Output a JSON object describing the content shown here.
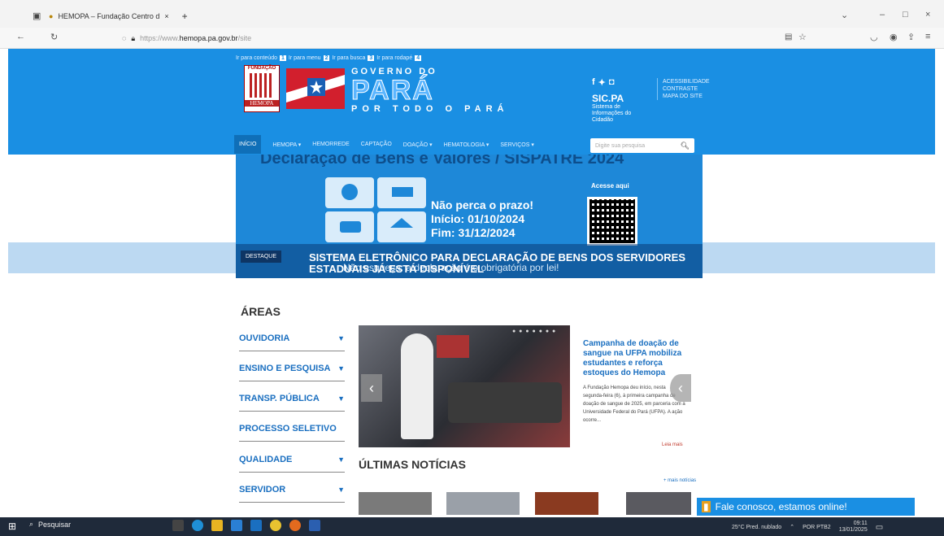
{
  "browser": {
    "tab_title": "HEMOPA – Fundação Centro d",
    "tab_close": "×",
    "new_tab": "+",
    "url_prefix": "https://www.",
    "url_domain": "hemopa.pa.gov.br",
    "url_path": "/site"
  },
  "skip_links": {
    "content": "Ir para conteúdo",
    "content_key": "1",
    "menu": "Ir para menu",
    "menu_key": "2",
    "search": "Ir para busca",
    "search_key": "3",
    "footer": "Ir para rodapé",
    "footer_key": "4"
  },
  "header": {
    "fundacao": "FUNDAÇÃO",
    "hemopa": "HEMOPA",
    "gov_title": "GOVERNO DO",
    "gov_para": "PARÁ",
    "gov_sub": "POR TODO O PARÁ",
    "sic_title": "SIC.PA",
    "sic_sub": "Sistema de Informações do Cidadão",
    "accessibility": [
      "ACESSIBILIDADE",
      "CONTRASTE",
      "MAPA DO SITE"
    ]
  },
  "nav": {
    "items": [
      "INÍCIO",
      "HEMOPA ▾",
      "HEMORREDE",
      "CAPTAÇÃO",
      "DOAÇÃO ▾",
      "HEMATOLOGIA ▾",
      "SERVIÇOS ▾"
    ],
    "search_placeholder": "Digite sua pesquisa"
  },
  "banner": {
    "title": "Declaração de Bens e Valores / SISPATRE 2024",
    "msg1": "Não perca o prazo!",
    "msg2": "Início: 01/10/2024",
    "msg3": "Fim: 31/12/2024",
    "qr_label": "Acesse aqui",
    "destaque": "DESTAQUE",
    "headline": "SISTEMA ELETRÔNICO PARA DECLARAÇÃO DE BENS DOS SERVIDORES ESTADUAIS JÁ ESTÁ DISPONÍVEL",
    "under": "Não esqueça: a declaração é o obrigatória por lei!"
  },
  "areas": {
    "title": "ÁREAS",
    "items": [
      {
        "label": "OUVIDORIA",
        "caret": "▼"
      },
      {
        "label": "ENSINO E PESQUISA",
        "caret": "▼"
      },
      {
        "label": "TRANSP. PÚBLICA",
        "caret": "▼"
      },
      {
        "label": "PROCESSO SELETIVO",
        "caret": ""
      },
      {
        "label": "QUALIDADE",
        "caret": "▼"
      },
      {
        "label": "SERVIDOR",
        "caret": "▼"
      }
    ]
  },
  "news": {
    "title": "Campanha de doação de sangue na UFPA mobiliza estudantes e reforça estoques do Hemopa",
    "body": "A Fundação Hemopa deu início, nesta segunda-feira (6), à primeira campanha de doação de sangue de 2025, em parceria com a Universidade Federal do Pará (UFPA). A ação ocorre...",
    "more": "Leia mais",
    "prev": "‹",
    "next": "‹",
    "latest_title": "ÚLTIMAS NOTÍCIAS",
    "more_news": "+ mais notícias"
  },
  "chat": {
    "label": "Fale conosco, estamos online!"
  },
  "taskbar": {
    "search": "Pesquisar",
    "weather": "25°C Pred. nublado",
    "lang": "POR PTB2",
    "time": "09:11",
    "date": "13/01/2025"
  },
  "colors": {
    "header": "#1a8fe3",
    "link": "#1a6fc0"
  }
}
